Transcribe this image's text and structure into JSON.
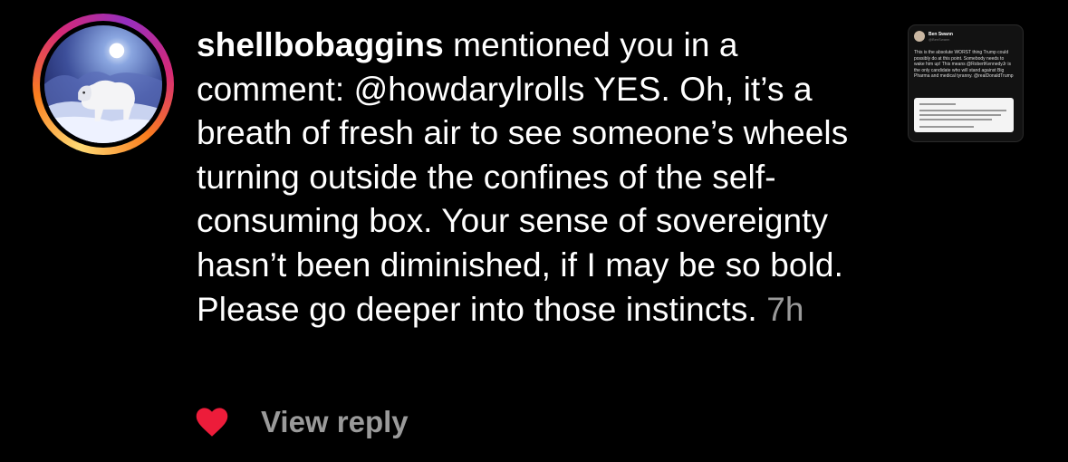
{
  "notification": {
    "username": "shellbobaggins",
    "message": " mentioned you in a comment: @howdarylrolls YES. Oh, it’s a breath of fresh air to see someone’s wheels turning outside the confines of the self-consuming box. Your sense of sovereignty hasn’t been diminished, if I may be so bold. Please go deeper into those instincts.",
    "time": "7h",
    "view_reply_label": "View reply",
    "liked": true,
    "heart_color": "#ed1c3a"
  },
  "thumbnail": {
    "author": "Ben Swann",
    "handle": "@BenSwann",
    "text": "This is the absolute WORST thing Trump could possibly do at this point. Somebody needs to wake him up! This means @RobertKennedyJr is the only candidate who will stand against Big Pharma and medical tyranny. @realDonaldTrump"
  }
}
